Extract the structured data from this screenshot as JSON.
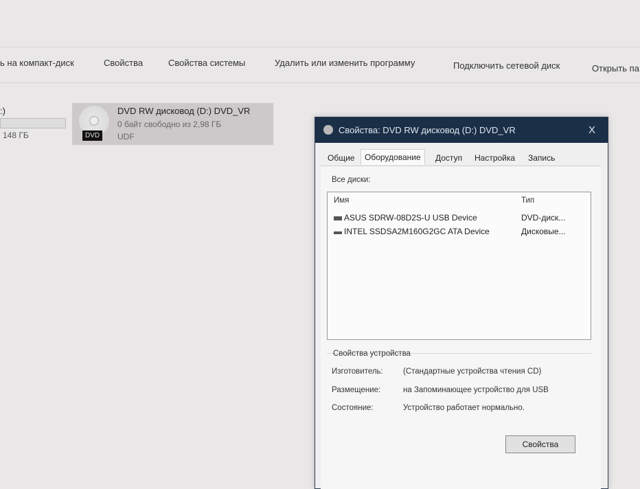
{
  "toolbar": {
    "items": [
      "ь на компакт-диск",
      "Свойства",
      "Свойства системы",
      "Удалить или изменить программу",
      "Подключить сетевой диск",
      "Открыть па"
    ]
  },
  "drives": {
    "left_partial": {
      "name": ":)",
      "size": "148 ГБ"
    },
    "dvd": {
      "name": "DVD RW дисковод (D:) DVD_VR",
      "free": "0 байт свободно из 2,98 ГБ",
      "fs": "UDF",
      "badge": "DVD"
    }
  },
  "dialog": {
    "title": "Свойства: DVD RW дисковод (D:) DVD_VR",
    "close": "X",
    "tabs": [
      "Общие",
      "Оборудование",
      "Доступ",
      "Настройка",
      "Запись"
    ],
    "selected_tab": "Оборудование",
    "all_disks_label": "Все диски:",
    "columns": [
      "Имя",
      "Тип"
    ],
    "disks": [
      {
        "name": "ASUS SDRW-08D2S-U USB Device",
        "type": "DVD-диск..."
      },
      {
        "name": "INTEL SSDSA2M160G2GC ATA Device",
        "type": "Дисковые..."
      }
    ],
    "device_props": {
      "title": "Свойства устройства",
      "rows": [
        {
          "label": "Изготовитель:",
          "value": "(Стандартные устройства чтения CD)"
        },
        {
          "label": "Размещение:",
          "value": "на Запоминающее устройство для USB"
        },
        {
          "label": "Состояние:",
          "value": "Устройство работает нормально."
        }
      ]
    },
    "properties_button": "Свойства"
  }
}
